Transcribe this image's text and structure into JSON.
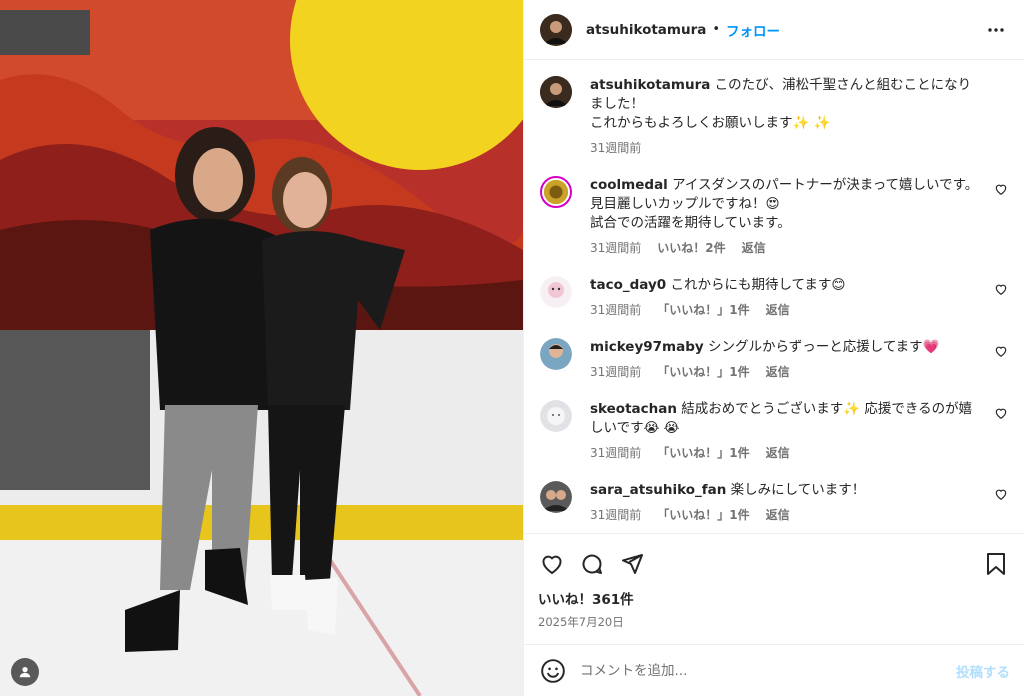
{
  "post": {
    "author": "atsuhikotamura",
    "follow_label": "フォロー",
    "separator": "•",
    "caption": {
      "username": "atsuhikotamura",
      "text": "このたび、浦松千聖さんと組むことになりました！\nこれからもよろしくお願いします✨ ✨",
      "time": "31週間前"
    },
    "likes": "いいね！361件",
    "date": "2025年7月20日"
  },
  "comments": [
    {
      "username": "coolmedal",
      "text": "アイスダンスのパートナーが決まって嬉しいです。\n見目麗しいカップルですね！😍\n試合での活躍を期待しています。",
      "time": "31週間前",
      "likes": "いいね！2件",
      "reply": "返信",
      "avatar_color": "#c9a227"
    },
    {
      "username": "taco_day0",
      "text": "これからにも期待してます😊",
      "time": "31週間前",
      "likes": "「いいね！」1件",
      "reply": "返信",
      "avatar_color": "#f3c6d6"
    },
    {
      "username": "mickey97maby",
      "text": "シングルからずっーと応援してます💗",
      "time": "31週間前",
      "likes": "「いいね！」1件",
      "reply": "返信",
      "avatar_color": "#7aa6c2"
    },
    {
      "username": "skeotachan",
      "text": "結成おめでとうございます✨ 応援できるのが嬉しいです😭 😭",
      "time": "31週間前",
      "likes": "「いいね！」1件",
      "reply": "返信",
      "avatar_color": "#e2e2e6"
    },
    {
      "username": "sara_atsuhiko_fan",
      "text": "楽しみにしています！",
      "time": "31週間前",
      "likes": "「いいね！」1件",
      "reply": "返信",
      "avatar_color": "#5a5a5a"
    }
  ],
  "comment_box": {
    "placeholder": "コメントを追加...",
    "post_label": "投稿する"
  },
  "icons": {
    "more": "more-horizontal-icon",
    "like": "heart-icon",
    "comment": "comment-icon",
    "share": "send-icon",
    "save": "bookmark-icon",
    "emoji": "emoji-icon",
    "tag": "user-tag-icon"
  },
  "colors": {
    "accent": "#0095f6",
    "post_disabled": "#b2dffc",
    "muted": "#737373"
  }
}
